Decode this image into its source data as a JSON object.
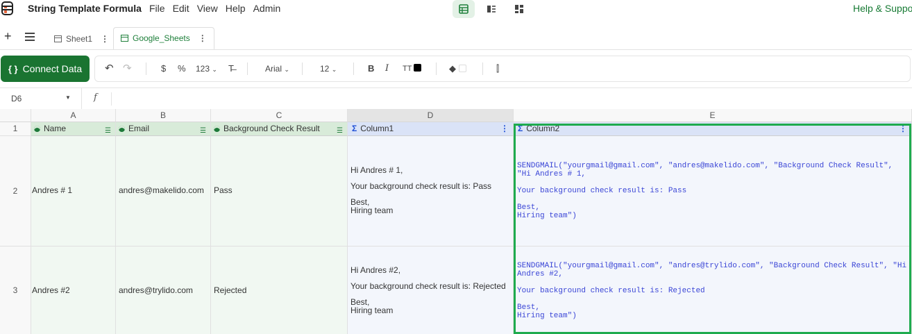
{
  "app": {
    "title": "String Template Formula"
  },
  "menu": [
    "File",
    "Edit",
    "View",
    "Help",
    "Admin"
  ],
  "view_switch": [
    {
      "icon": "grid-view-icon",
      "active": true
    },
    {
      "icon": "form-view-icon",
      "active": false
    },
    {
      "icon": "dashboard-view-icon",
      "active": false
    }
  ],
  "help_link": "Help & Suppo",
  "tabs": {
    "add_icon": "plus-icon",
    "list_icon": "hamburger-icon",
    "items": [
      {
        "label": "Sheet1",
        "active": false
      },
      {
        "label": "Google_Sheets",
        "active": true
      }
    ]
  },
  "toolbar": {
    "connect_label": "Connect Data",
    "currency": "$",
    "percent": "%",
    "number_format": "123",
    "font_family": "Arial",
    "font_size": "12",
    "bold": "B",
    "italic": "I",
    "text_size_icon": "TT",
    "text_color": "#000000",
    "fill_color": "#ffffff"
  },
  "formula_bar": {
    "cell_ref": "D6",
    "fx": "f",
    "value": ""
  },
  "grid": {
    "columns": [
      "A",
      "B",
      "C",
      "D",
      "E"
    ],
    "selected_column": "D",
    "header_row": {
      "row": "1",
      "cells": [
        {
          "label": "Name",
          "kind": "source"
        },
        {
          "label": "Email",
          "kind": "source"
        },
        {
          "label": "Background Check Result",
          "kind": "source"
        },
        {
          "label": "Column1",
          "kind": "formula"
        },
        {
          "label": "Column2",
          "kind": "formula"
        }
      ]
    },
    "rows": [
      {
        "row": "2",
        "name": "Andres # 1",
        "email": "andres@makelido.com",
        "result": "Pass",
        "column1": [
          "Hi Andres # 1,",
          "",
          "Your background check result is: Pass",
          "",
          "Best,",
          "Hiring team"
        ],
        "column2": [
          "SENDGMAIL(\"yourgmail@gmail.com\", \"andres@makelido.com\", \"Background Check Result\",",
          "\"Hi Andres # 1,",
          "",
          "Your background check result is: Pass",
          "",
          "Best,",
          "Hiring team\")"
        ]
      },
      {
        "row": "3",
        "name": "Andres #2",
        "email": "andres@trylido.com",
        "result": "Rejected",
        "column1": [
          "Hi Andres #2,",
          "",
          "Your background check result is: Rejected",
          "",
          "Best,",
          "Hiring team"
        ],
        "column2": [
          "SENDGMAIL(\"yourgmail@gmail.com\", \"andres@trylido.com\", \"Background Check Result\", \"Hi",
          "Andres #2,",
          "",
          "Your background check result is: Rejected",
          "",
          "Best,",
          "Hiring team\")"
        ]
      }
    ]
  }
}
